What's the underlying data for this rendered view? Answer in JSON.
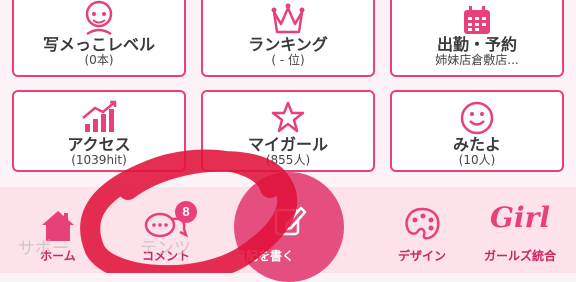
{
  "tiles": [
    {
      "label": "写メっこレベル",
      "sub": "(0本)",
      "icon": "photo-girl-icon"
    },
    {
      "label": "ランキング",
      "sub": "( - 位)",
      "icon": "crown-icon"
    },
    {
      "label": "出勤・予約",
      "sub": "姉妹店倉敷店...",
      "icon": "calendar-icon"
    },
    {
      "label": "アクセス",
      "sub": "(1039hit)",
      "icon": "bar-chart-icon"
    },
    {
      "label": "マイガール",
      "sub": "(855人)",
      "icon": "star-icon"
    },
    {
      "label": "みたよ",
      "sub": "(10人)",
      "icon": "smiley-icon"
    }
  ],
  "nav": {
    "home": "ホーム",
    "comments": "コメント",
    "comments_badge": "8",
    "write_diary": "日記を書く",
    "design": "デザイン",
    "girls": "ガールズ統合",
    "girls_logo": "Girl",
    "ghost_left": "サポー",
    "ghost_right": "テンツ"
  },
  "colors": {
    "accent": "#e8417a",
    "nav_bg": "#fde2ea",
    "fab": "#e54f7f",
    "scribble": "#e0123a"
  }
}
